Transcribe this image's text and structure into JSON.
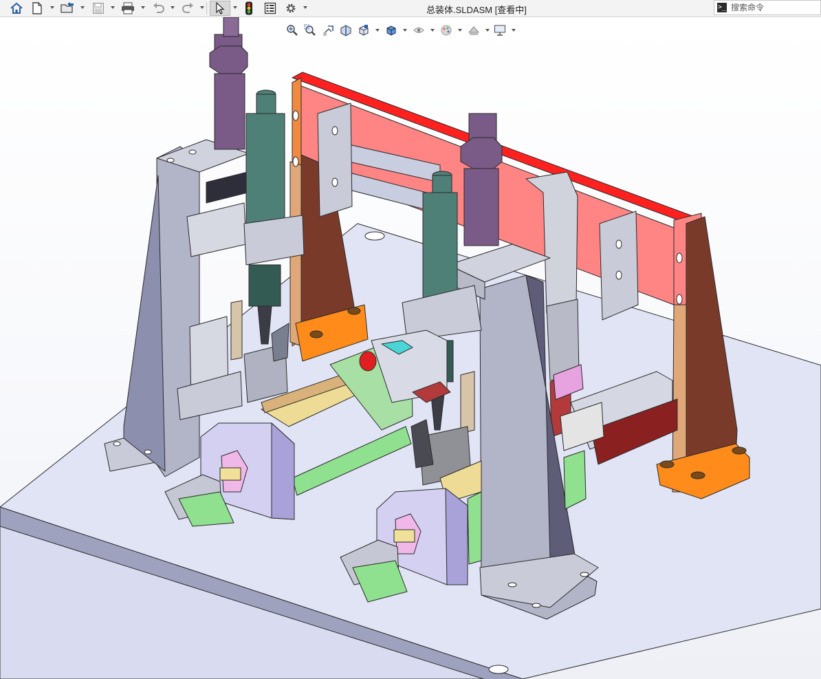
{
  "window": {
    "title": "总装体.SLDASM [查看中]"
  },
  "toolbar": {
    "left_icons": [
      "home-icon",
      "new-document-icon",
      "open-folder-icon",
      "save-icon",
      "print-icon",
      "undo-icon",
      "redo-icon",
      "select-arrow-icon",
      "traffic-light-icon",
      "file-properties-icon",
      "settings-gear-icon"
    ]
  },
  "search": {
    "placeholder": "搜索命令"
  },
  "heads_up_toolbar": {
    "icons": [
      "zoom-to-fit-icon",
      "zoom-to-area-icon",
      "previous-view-icon",
      "section-view-icon",
      "view-orientation-icon",
      "display-style-icon",
      "hide-show-items-icon",
      "edit-appearance-icon",
      "apply-scene-icon",
      "view-settings-icon"
    ]
  },
  "colors": {
    "plate": "#dfe3f5",
    "red_bar": "#ff2020",
    "salmon_panel": "#ff8080",
    "orange_block": "#ff8c1a",
    "brown_bracket": "#7a3a2a",
    "purple_cylinder": "#7a5a86",
    "teal_cylinder": "#4f8078",
    "steel": "#8f8fa8",
    "green_block": "#8fe08f",
    "yellow_rail": "#f0e09a"
  }
}
